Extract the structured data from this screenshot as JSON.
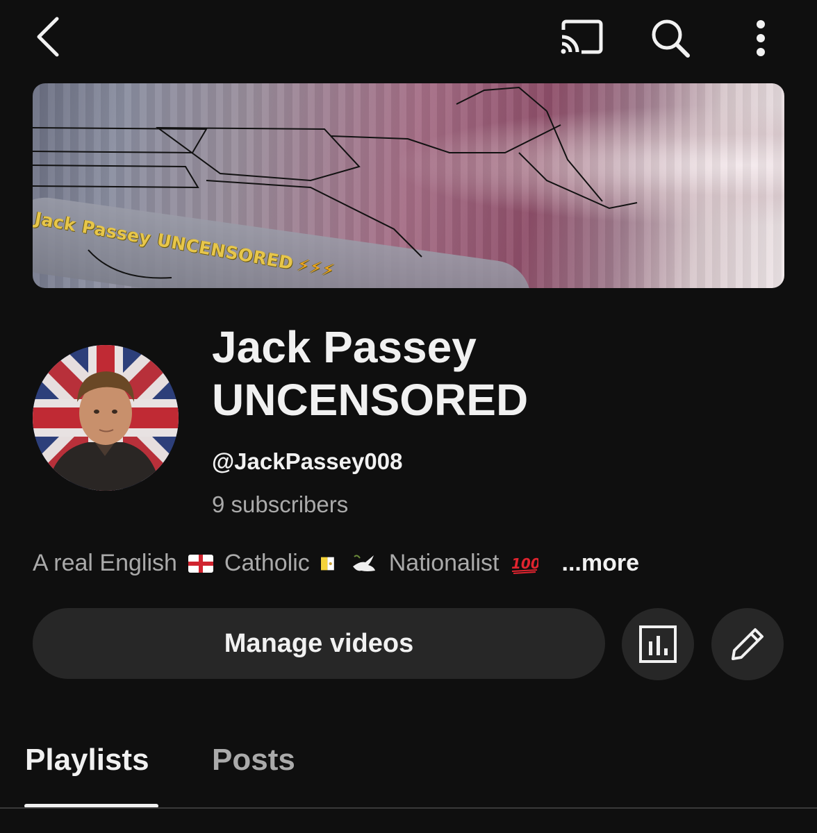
{
  "topbar": {
    "back_icon": "chevron-left-icon",
    "cast_icon": "cast-icon",
    "search_icon": "search-icon",
    "more_icon": "more-vertical-icon"
  },
  "banner": {
    "text": "Jack Passey UNCENSORED",
    "bolts": "⚡⚡⚡"
  },
  "channel": {
    "name": "Jack Passey UNCENSORED",
    "handle": "@JackPassey008",
    "subscribers": "9 subscribers",
    "description": {
      "part1": "A real English",
      "part2": "Catholic",
      "part3": "Nationalist",
      "more_label": "...more"
    }
  },
  "actions": {
    "manage_videos_label": "Manage videos",
    "analytics_icon": "bar-chart-icon",
    "edit_icon": "pencil-icon"
  },
  "tabs": [
    {
      "label": "Playlists",
      "active": true
    },
    {
      "label": "Posts",
      "active": false
    }
  ],
  "colors": {
    "background": "#0f0f0f",
    "text_primary": "#f1f1f1",
    "text_secondary": "#aaaaaa",
    "button_bg": "#272727",
    "banner_text": "#e7c64a"
  }
}
